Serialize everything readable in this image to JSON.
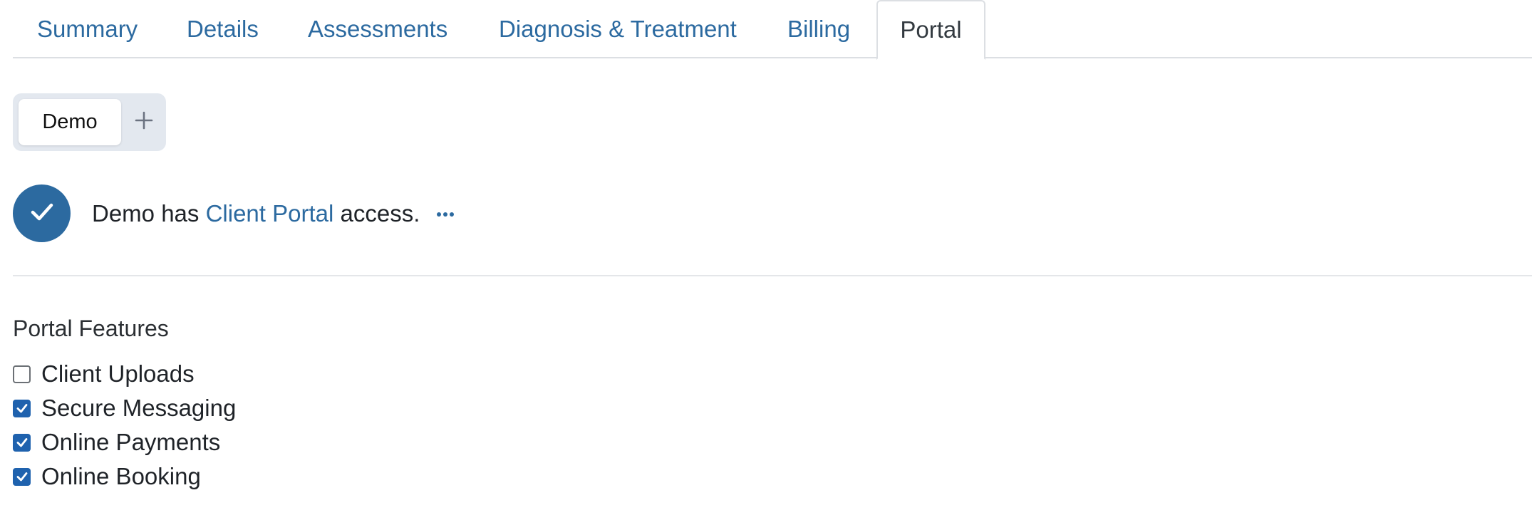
{
  "tabs": [
    {
      "label": "Summary",
      "active": false
    },
    {
      "label": "Details",
      "active": false
    },
    {
      "label": "Assessments",
      "active": false
    },
    {
      "label": "Diagnosis & Treatment",
      "active": false
    },
    {
      "label": "Billing",
      "active": false
    },
    {
      "label": "Portal",
      "active": true
    }
  ],
  "clients": {
    "selected": "Demo",
    "add_icon": "plus-icon"
  },
  "access": {
    "status_icon": "checkmark-icon",
    "prefix": "Demo has ",
    "link_text": "Client Portal",
    "suffix": " access.",
    "more_icon": "more-horizontal-icon"
  },
  "features": {
    "title": "Portal Features",
    "items": [
      {
        "label": "Client Uploads",
        "checked": false
      },
      {
        "label": "Secure Messaging",
        "checked": true
      },
      {
        "label": "Online Payments",
        "checked": true
      },
      {
        "label": "Online Booking",
        "checked": true
      }
    ]
  },
  "colors": {
    "accent": "#2c6aa0",
    "checkbox_checked": "#1f62ae",
    "pill_group_bg": "#e3e8ef",
    "border": "#dcdfe3"
  }
}
